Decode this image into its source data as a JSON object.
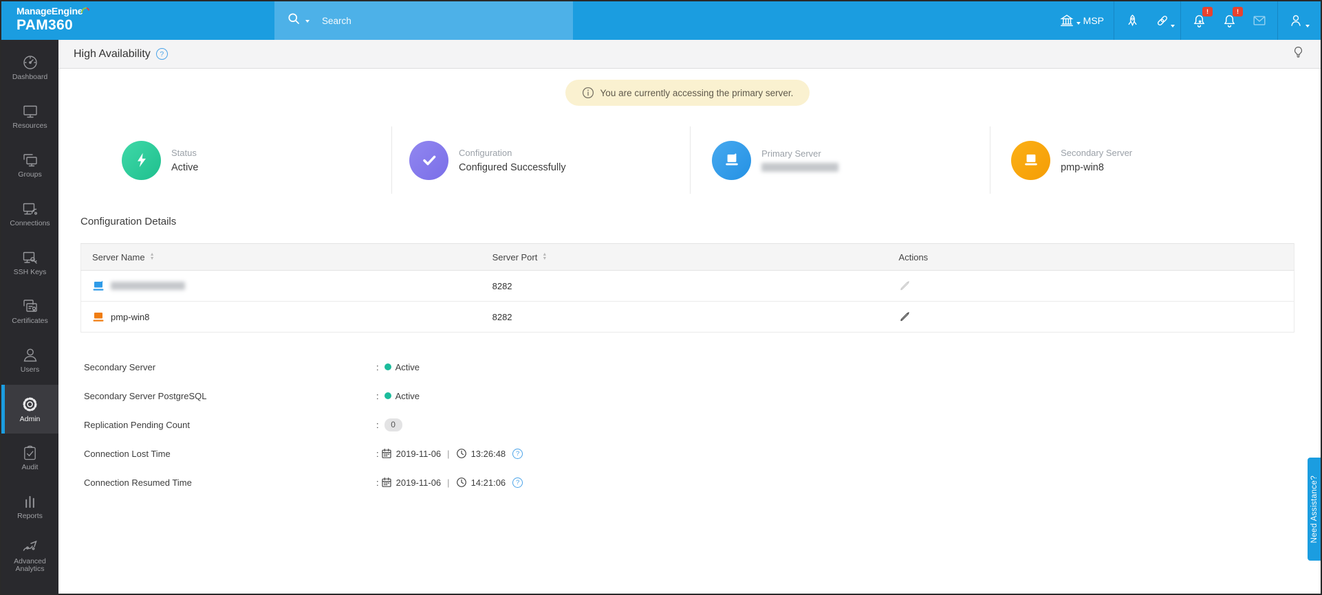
{
  "topbar": {
    "brand_line1": "ManageEngine",
    "brand_line2": "PAM360",
    "search_placeholder": "Search",
    "org_label": "MSP",
    "icons": [
      "bank-icon",
      "rocket-icon",
      "link-icon",
      "bell-star-icon",
      "bell-icon",
      "envelope-icon",
      "user-icon"
    ],
    "notification_badge": "!",
    "colors": {
      "bar": "#1b9de0",
      "search_strip": "#4db1e8",
      "badge": "#e8422e"
    }
  },
  "sidebar": {
    "items": [
      {
        "label": "Dashboard",
        "selected": false
      },
      {
        "label": "Resources",
        "selected": false
      },
      {
        "label": "Groups",
        "selected": false
      },
      {
        "label": "Connections",
        "selected": false
      },
      {
        "label": "SSH Keys",
        "selected": false
      },
      {
        "label": "Certificates",
        "selected": false
      },
      {
        "label": "Users",
        "selected": false
      },
      {
        "label": "Admin",
        "selected": true
      },
      {
        "label": "Audit",
        "selected": false
      },
      {
        "label": "Reports",
        "selected": false
      },
      {
        "label": "Advanced Analytics",
        "selected": false
      }
    ],
    "colors": {
      "background": "#29292d",
      "selected_bar": "#1b9de0"
    }
  },
  "header": {
    "title": "High Availability",
    "help": "?"
  },
  "banner": {
    "text": "You are currently accessing the primary server.",
    "background": "#faf1d0"
  },
  "cards": [
    {
      "label": "Status",
      "value": "Active",
      "color": "#2fcb9b",
      "icon": "bolt-icon",
      "blurred": false
    },
    {
      "label": "Configuration",
      "value": "Configured Successfully",
      "color": "#8678ec",
      "icon": "check-icon",
      "blurred": false
    },
    {
      "label": "Primary Server",
      "value": "",
      "color": "#2f9be8",
      "icon": "computer-icon",
      "blurred": true
    },
    {
      "label": "Secondary Server",
      "value": "pmp-win8",
      "color": "#f8a40c",
      "icon": "laptop-icon",
      "blurred": false
    }
  ],
  "section": {
    "title": "Configuration Details"
  },
  "table": {
    "columns": [
      "Server Name",
      "Server Port",
      "Actions"
    ],
    "rows": [
      {
        "name": "",
        "blurred": true,
        "port": "8282",
        "icon_color": "#2f9be8",
        "action": "edit",
        "action_enabled": false
      },
      {
        "name": "pmp-win8",
        "blurred": false,
        "port": "8282",
        "icon_color": "#f07d12",
        "action": "edit",
        "action_enabled": true
      }
    ]
  },
  "details": [
    {
      "label": "Secondary Server",
      "type": "status",
      "value": "Active",
      "status_color": "#1cbc9c"
    },
    {
      "label": "Secondary Server PostgreSQL",
      "type": "status",
      "value": "Active",
      "status_color": "#1cbc9c"
    },
    {
      "label": "Replication Pending Count",
      "type": "badge",
      "value": "0"
    },
    {
      "label": "Connection Lost Time",
      "type": "datetime",
      "date": "2019-11-06",
      "separator": "|",
      "time": "13:26:48",
      "help": "?"
    },
    {
      "label": "Connection Resumed Time",
      "type": "datetime",
      "date": "2019-11-06",
      "separator": "|",
      "time": "14:21:06",
      "help": "?"
    }
  ],
  "assist_tab": {
    "label": "Need Assistance?"
  }
}
